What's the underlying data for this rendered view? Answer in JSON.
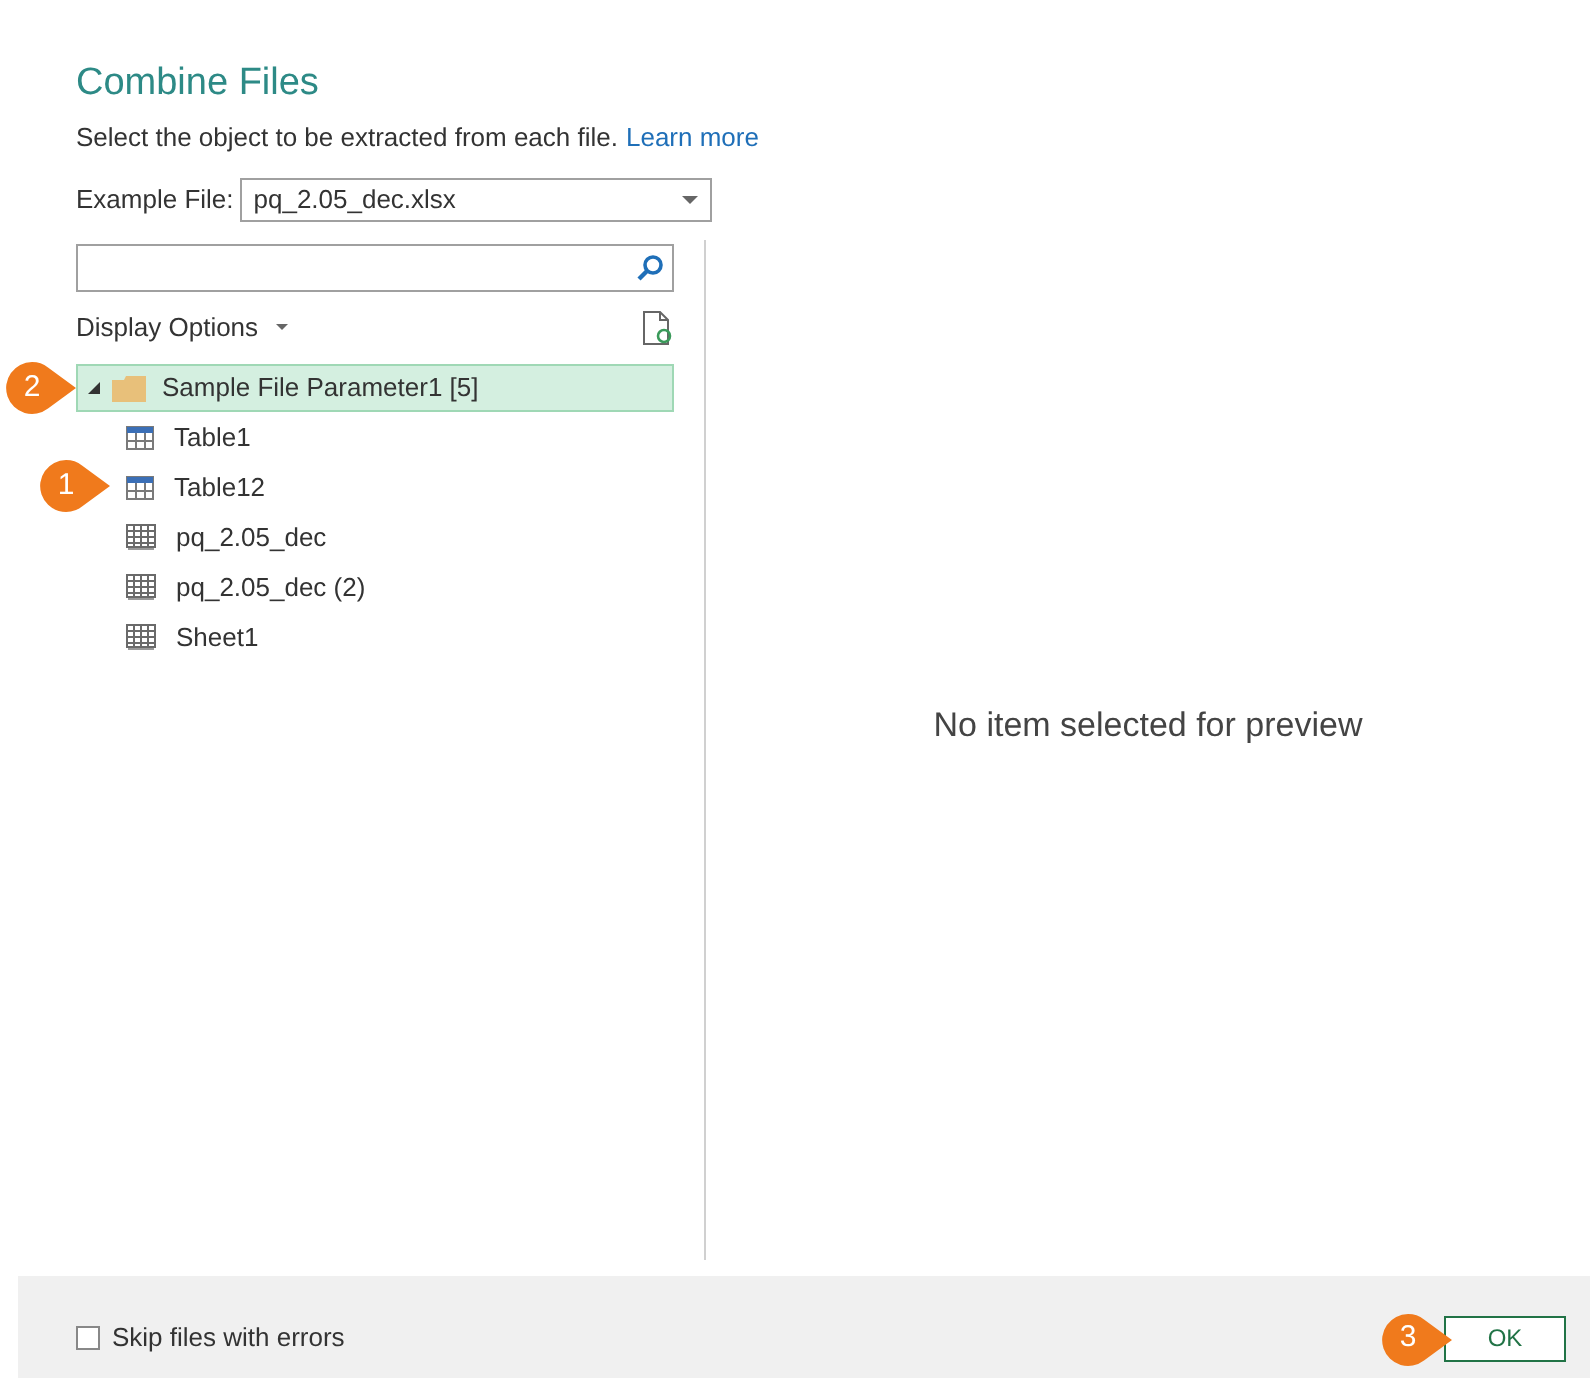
{
  "dialog": {
    "title": "Combine Files",
    "description": "Select the object to be extracted from each file.",
    "learn_more": "Learn more",
    "example_file": {
      "label": "Example File:",
      "value": "pq_2.05_dec.xlsx"
    },
    "display_options": "Display Options",
    "tree": {
      "label": "Sample File Parameter1 [5]",
      "expanded": true,
      "selected": true,
      "callout": "2",
      "children": [
        {
          "label": "Table1",
          "kind": "table",
          "selected": false
        },
        {
          "label": "Table12",
          "kind": "table",
          "selected": false,
          "callout": "1"
        },
        {
          "label": "pq_2.05_dec",
          "kind": "sheet",
          "selected": false
        },
        {
          "label": "pq_2.05_dec (2)",
          "kind": "sheet",
          "selected": false
        },
        {
          "label": "Sheet1",
          "kind": "sheet",
          "selected": false
        }
      ]
    },
    "preview_message": "No item selected for preview",
    "skip_errors": {
      "label": "Skip files with errors",
      "checked": false
    },
    "ok_button": {
      "label": "OK",
      "callout": "3"
    }
  }
}
